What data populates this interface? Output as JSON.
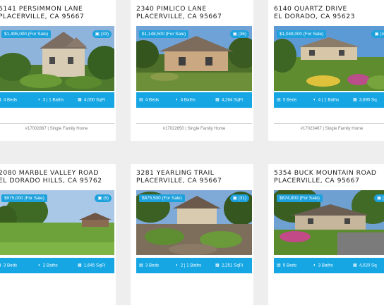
{
  "listings": [
    {
      "address_line1": "6141 PERSIMMON LANE",
      "address_line2": "PLACERVILLE, CA 95667",
      "price": "$1,495,000",
      "status": "(For Sale)",
      "photo_count": "(33)",
      "beds": "4 Beds",
      "baths": "3 | 1 Baths",
      "sqft": "4,000 SqFt",
      "mls": "#17002867",
      "type": "Single Family Home"
    },
    {
      "address_line1": "2340 PIMLICO LANE",
      "address_line2": "PLACERVILLE, CA 95667",
      "price": "$1,148,500",
      "status": "(For Sale)",
      "photo_count": "(36)",
      "beds": "4 Beds",
      "baths": "4 Baths",
      "sqft": "4,284 SqFt",
      "mls": "#17022650",
      "type": "Single Family Home"
    },
    {
      "address_line1": "6140 QUARTZ DRIVE",
      "address_line2": "EL DORADO, CA 95623",
      "price": "$1,049,000",
      "status": "(For Sale)",
      "photo_count": "(4",
      "beds": "5 Beds",
      "baths": "4 | 1 Baths",
      "sqft": "3,690 Sq",
      "mls": "#17023467",
      "type": "Single Family Home"
    },
    {
      "address_line1": "2080 MARBLE VALLEY ROAD",
      "address_line2": "EL DORADO HILLS, CA 95762",
      "price": "$975,000",
      "status": "(For Sale)",
      "photo_count": "(9)",
      "beds": "3 Beds",
      "baths": "2 Baths",
      "sqft": "1,645 SqFt",
      "mls": "",
      "type": ""
    },
    {
      "address_line1": "3281 YEARLING TRAIL",
      "address_line2": "PLACERVILLE, CA 95667",
      "price": "$875,500",
      "status": "(For Sale)",
      "photo_count": "(31)",
      "beds": "3 Beds",
      "baths": "2 | 1 Baths",
      "sqft": "2,251 SqFt",
      "mls": "",
      "type": ""
    },
    {
      "address_line1": "5354 BUCK MOUNTAIN ROAD",
      "address_line2": "PLACERVILLE, CA 95667",
      "price": "$874,900",
      "status": "(For Sale)",
      "photo_count": "(",
      "beds": "5 Beds",
      "baths": "3 Baths",
      "sqft": "4,020 Sq",
      "mls": "",
      "type": ""
    }
  ],
  "colors": {
    "accent": "#15a6e3",
    "badge": "#1da1dc",
    "page_bg": "#eeeeee"
  },
  "icons": {
    "beds": "bed-icon",
    "baths": "bathtub-icon",
    "sqft": "floorplan-icon",
    "photos": "camera-icon"
  }
}
